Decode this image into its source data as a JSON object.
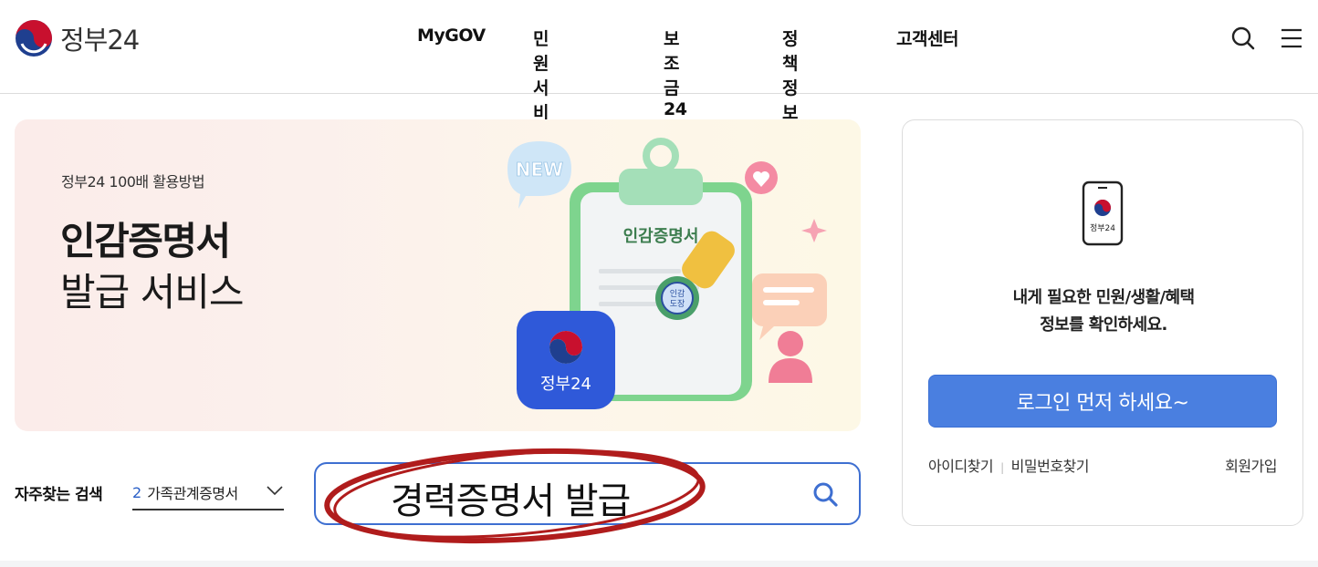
{
  "header": {
    "logo_text": "정부24",
    "nav": [
      "MyGOV",
      "민원서비스",
      "보조금24",
      "정책정보",
      "고객센터"
    ],
    "icons": [
      "search-icon",
      "hamburger-menu-icon"
    ]
  },
  "banner": {
    "subtitle": "정부24 100배 활용방법",
    "title_bold": "인감증명서",
    "title_regular": "발급 서비스",
    "art": {
      "new_badge": "NEW",
      "clipboard_title": "인감증명서",
      "stamp_text_1": "인감",
      "stamp_text_2": "도장",
      "app_label": "정부24"
    }
  },
  "search": {
    "frequent_label": "자주찾는 검색",
    "frequent_number": "2",
    "frequent_item": "가족관계증명서",
    "query": "경력증명서 발급",
    "annotation_color": "#b01c1c"
  },
  "login": {
    "phone_label": "정부24",
    "message_line1": "내게 필요한 민원/생활/혜택",
    "message_line2": "정보를 확인하세요.",
    "button_label": "로그인 먼저 하세요~",
    "find_id": "아이디찾기",
    "separator": "|",
    "find_password": "비밀번호찾기",
    "signup": "회원가입"
  },
  "colors": {
    "accent": "#3e6fd1",
    "button": "#4a7fe0",
    "taegeuk_red": "#c8102e",
    "taegeuk_blue": "#1f3f8f"
  }
}
